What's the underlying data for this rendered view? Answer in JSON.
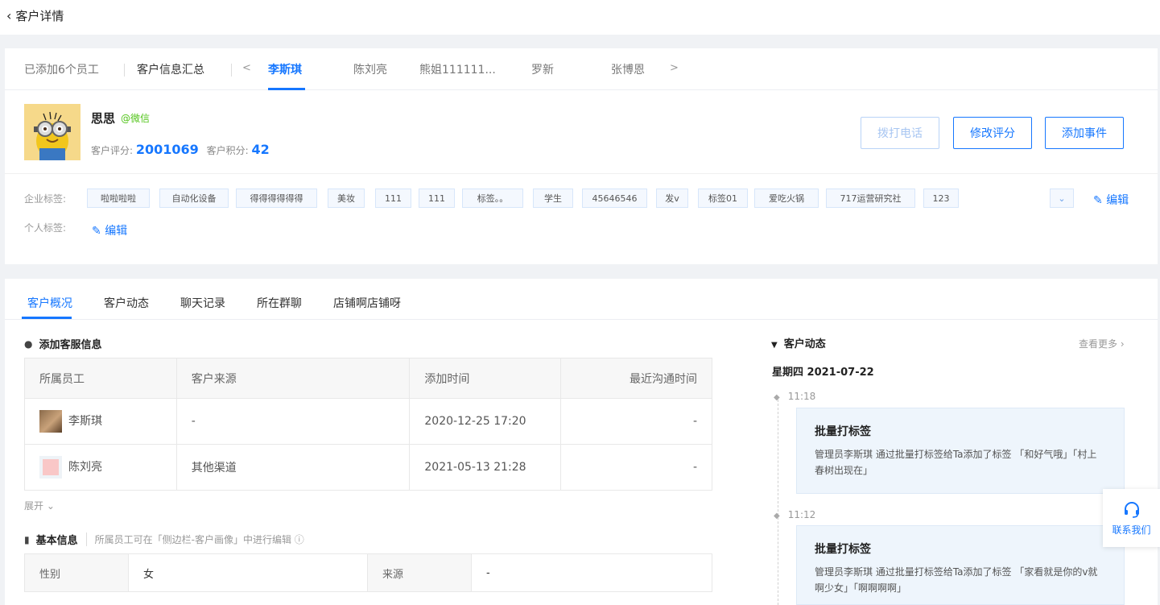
{
  "page": {
    "back_label": "客户详情"
  },
  "staff_tabs": {
    "added": "已添加6个员工",
    "summary": "客户信息汇总",
    "prev": "<",
    "next": ">",
    "staff": [
      {
        "name": "李斯琪",
        "active": true
      },
      {
        "name": "陈刘亮"
      },
      {
        "name": "熊姐111111..."
      },
      {
        "name": "罗新"
      },
      {
        "name": "张博恩"
      }
    ]
  },
  "customer": {
    "name": "思思",
    "source": "@微信",
    "score_label": "客户评分:",
    "score": "2001069",
    "points_label": "客户积分:",
    "points": "42"
  },
  "actions": {
    "call": "拨打电话",
    "edit_score": "修改评分",
    "add_event": "添加事件"
  },
  "tags": {
    "corp_label": "企业标签:",
    "personal_label": "个人标签:",
    "edit": "编辑",
    "corp_tags": [
      "啦啦啦啦",
      "自动化设备",
      "得得得得得得",
      "美妆",
      "111",
      "111",
      "标签。。",
      "学生",
      "45646546",
      "发v",
      "标签01",
      "爱吃火锅",
      "717运营研究社",
      "123"
    ]
  },
  "sub_tabs": [
    "客户概况",
    "客户动态",
    "聊天记录",
    "所在群聊",
    "店铺啊店铺呀"
  ],
  "service": {
    "title": "添加客服信息",
    "columns": [
      "所属员工",
      "客户来源",
      "添加时间",
      "最近沟通时间"
    ],
    "rows": [
      {
        "staff": "李斯琪",
        "source": "-",
        "added": "2020-12-25 17:20",
        "last": "-"
      },
      {
        "staff": "陈刘亮",
        "source": "其他渠道",
        "added": "2021-05-13 21:28",
        "last": "-"
      }
    ],
    "expand": "展开"
  },
  "basic": {
    "title": "基本信息",
    "hint": "所属员工可在「侧边栏-客户画像」中进行编辑",
    "gender_label": "性别",
    "gender": "女",
    "source_label": "来源",
    "source": "-"
  },
  "activity": {
    "title": "客户动态",
    "more": "查看更多",
    "date": "星期四 2021-07-22",
    "events": [
      {
        "time": "11:18",
        "title": "批量打标签",
        "desc": "管理员李斯琪  通过批量打标签给Ta添加了标签 「和好气哦」「村上春树出现在」"
      },
      {
        "time": "11:12",
        "title": "批量打标签",
        "desc": "管理员李斯琪  通过批量打标签给Ta添加了标签 「家看就是你的v就啊少女」「啊啊啊啊」"
      }
    ]
  },
  "contact": {
    "label": "联系我们"
  }
}
